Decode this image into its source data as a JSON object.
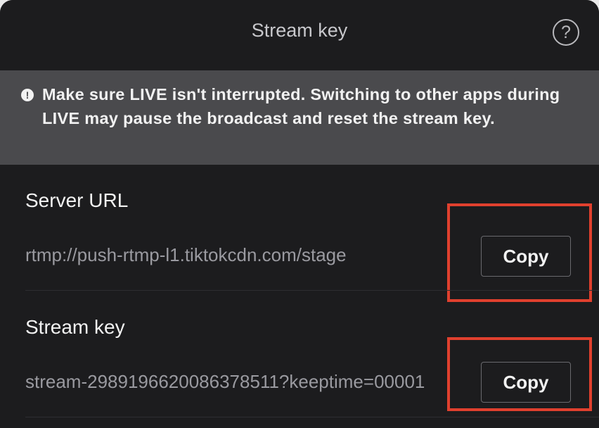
{
  "header": {
    "title": "Stream key",
    "help_symbol": "?"
  },
  "notice": {
    "icon_symbol": "!",
    "text": "Make sure LIVE isn't interrupted. Switching to other apps during LIVE may pause the broadcast and reset the stream key."
  },
  "server_url": {
    "label": "Server URL",
    "value": "rtmp://push-rtmp-l1.tiktokcdn.com/stage",
    "copy_label": "Copy"
  },
  "stream_key": {
    "label": "Stream key",
    "value": "stream-2989196620086378511?keeptime=00001",
    "copy_label": "Copy"
  },
  "colors": {
    "panel_bg": "#1c1c1e",
    "notice_bg": "#4a4a4d",
    "highlight": "#e0402e"
  }
}
